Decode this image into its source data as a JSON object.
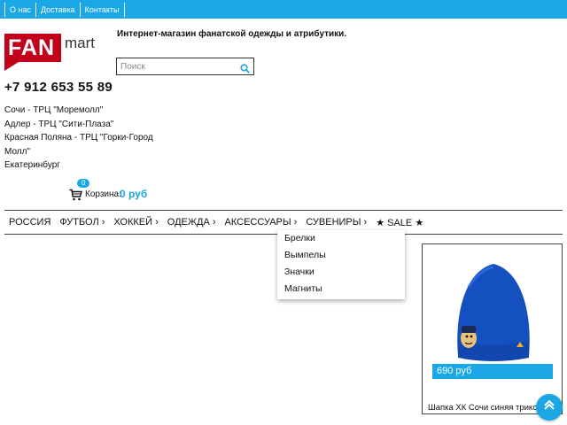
{
  "topbar": {
    "links": [
      "О нас",
      "Доставка",
      "Контакты"
    ]
  },
  "logo": {
    "fan": "FAN",
    "mart": "mart"
  },
  "tagline": "Интернет-магазин фанатской одежды и атрибутики.",
  "search": {
    "placeholder": "Поиск"
  },
  "phone": "+7 912 653 55 89",
  "stores": [
    "Сочи - ТРЦ \"Моремолл\"",
    "Адлер - ТРЦ \"Сити-Плаза\"",
    "Красная Поляна - ТРЦ \"Горки-Город",
    "Молл\"",
    "Екатеринбург"
  ],
  "cart": {
    "count": "0",
    "label": "Корзина:",
    "total": "0 руб"
  },
  "nav": {
    "items": [
      "РОССИЯ",
      "ФУТБОЛ ›",
      "ХОККЕЙ ›",
      "ОДЕЖДА ›",
      "АКСЕССУАРЫ ›",
      "СУВЕНИРЫ ›",
      "★ SALE ★"
    ]
  },
  "dropdown": {
    "items": [
      "Брелки",
      "Вымпелы",
      "Значки",
      "Магниты"
    ]
  },
  "product": {
    "price": "690 руб",
    "name": "Шапка ХК Сочи синяя трикотаж"
  },
  "colors": {
    "accent": "#1aa7e5",
    "brand_red": "#c2001a",
    "hat_blue": "#1550c0"
  },
  "icons": {
    "search": "search-icon",
    "cart": "cart-icon",
    "scroll_top": "chevron-up-icon"
  }
}
